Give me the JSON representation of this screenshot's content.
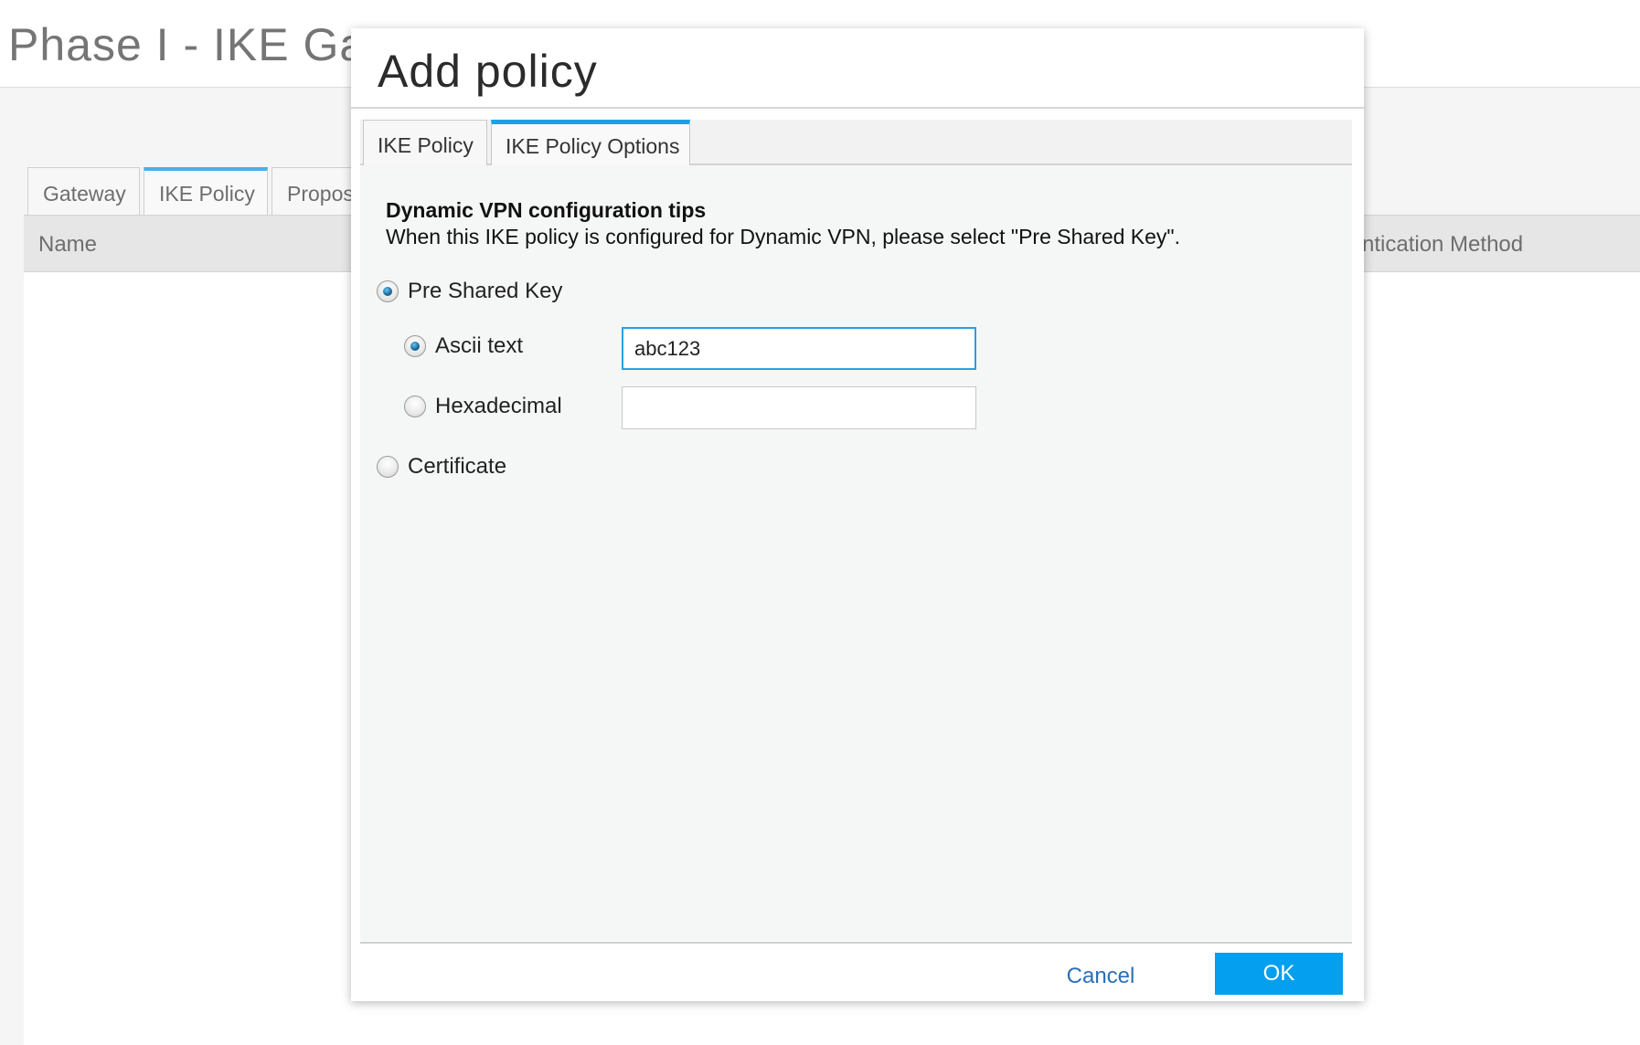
{
  "background": {
    "title": "Phase I - IKE Ga",
    "tabs": [
      {
        "label": "Gateway",
        "active": false
      },
      {
        "label": "IKE Policy",
        "active": true
      },
      {
        "label": "Propos",
        "active": false
      }
    ],
    "columns": {
      "name": "Name",
      "auth_method": "ntication Method"
    }
  },
  "modal": {
    "title": "Add policy",
    "tabs": [
      {
        "label": "IKE Policy",
        "active": false
      },
      {
        "label": "IKE Policy Options",
        "active": true
      }
    ],
    "tips": {
      "title": "Dynamic VPN configuration tips",
      "text": "When this IKE policy is configured for Dynamic VPN, please select \"Pre Shared Key\"."
    },
    "options": {
      "pre_shared_key": {
        "label": "Pre Shared Key",
        "checked": true
      },
      "ascii_text": {
        "label": "Ascii text",
        "checked": true,
        "value": "abc123"
      },
      "hexadecimal": {
        "label": "Hexadecimal",
        "checked": false,
        "value": ""
      },
      "certificate": {
        "label": "Certificate",
        "checked": false
      }
    },
    "footer": {
      "cancel_label": "Cancel",
      "ok_label": "OK"
    }
  },
  "colors": {
    "accent": "#1aa0e8",
    "ok_button": "#049fef",
    "cancel_link": "#2a6fb6"
  }
}
